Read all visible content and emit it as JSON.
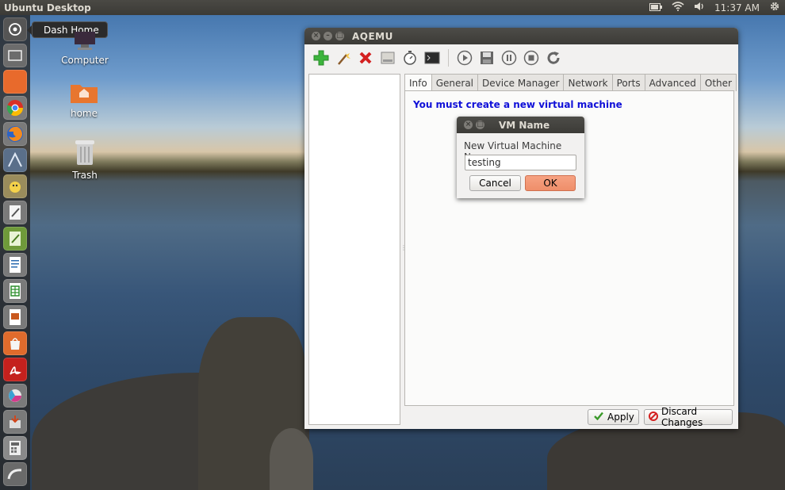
{
  "top_panel": {
    "title": "Ubuntu Desktop",
    "time": "11:37 AM",
    "icons": [
      "battery-icon",
      "wifi-icon",
      "volume-icon",
      "gear-icon"
    ]
  },
  "launcher": {
    "tooltip": "Dash Home",
    "items": [
      "dash-home",
      "workspace-switcher",
      "files",
      "chromium",
      "firefox",
      "inkscape",
      "pidgin",
      "text-editor",
      "gedit",
      "writer",
      "calc",
      "impress",
      "software-center",
      "pdf-reader",
      "image-viewer",
      "system-installer",
      "calculator",
      "workspace"
    ]
  },
  "desktop_icons": {
    "computer": "Computer",
    "home": "home",
    "trash": "Trash"
  },
  "aqemu": {
    "title": "AQEMU",
    "toolbar": [
      "add-icon",
      "wizard-icon",
      "delete-icon",
      "disk-icon",
      "timer-icon",
      "terminal-icon",
      "play-icon",
      "save-icon",
      "pause-icon",
      "stop-icon",
      "reload-icon"
    ],
    "tabs": [
      "Info",
      "General",
      "Device Manager",
      "Network",
      "Ports",
      "Advanced",
      "Other"
    ],
    "active_tab": "Info",
    "info_message": "You must create a new virtual machine",
    "apply_label": "Apply",
    "discard_label": "Discard Changes"
  },
  "dialog": {
    "title": "VM Name",
    "label": "New Virtual Machine Name:",
    "input_value": "testing",
    "cancel_label": "Cancel",
    "ok_label": "OK"
  },
  "colors": {
    "ok_button": "#f08f6a",
    "info_text": "#1010d8",
    "panel": "#3c3b37"
  }
}
